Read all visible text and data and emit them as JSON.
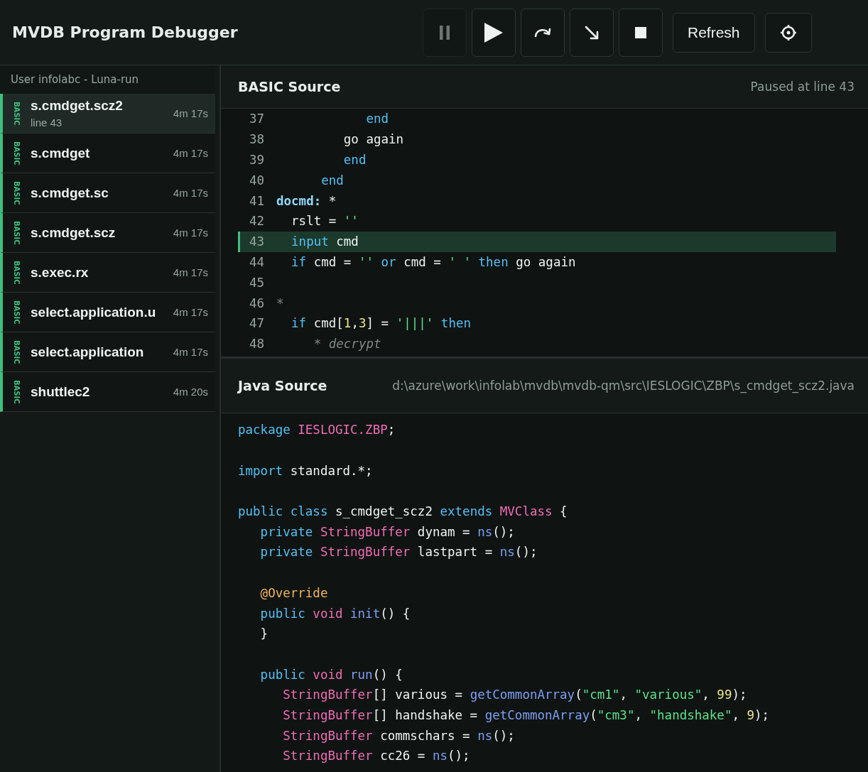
{
  "app": {
    "title": "MVDB Program Debugger"
  },
  "toolbar": {
    "buttons": [
      {
        "kind": "pause",
        "disabled": true
      },
      {
        "kind": "play",
        "disabled": false
      },
      {
        "kind": "step-over",
        "disabled": false
      },
      {
        "kind": "step-into",
        "disabled": false
      },
      {
        "kind": "stop",
        "disabled": false
      },
      {
        "kind": "text",
        "label": "Refresh",
        "disabled": false
      },
      {
        "kind": "settings",
        "disabled": false
      }
    ]
  },
  "sidebar": {
    "heading": "User infolabc - Luna-run",
    "items": [
      {
        "tag": "BASIC",
        "name": "s.cmdget.scz2",
        "time": "4m 17s",
        "detail": "line 43",
        "selected": true
      },
      {
        "tag": "BASIC",
        "name": "s.cmdget",
        "time": "4m 17s",
        "selected": false
      },
      {
        "tag": "BASIC",
        "name": "s.cmdget.sc",
        "time": "4m 17s",
        "selected": false
      },
      {
        "tag": "BASIC",
        "name": "s.cmdget.scz",
        "time": "4m 17s",
        "selected": false
      },
      {
        "tag": "BASIC",
        "name": "s.exec.rx",
        "time": "4m 17s",
        "selected": false
      },
      {
        "tag": "BASIC",
        "name": "select.application.u",
        "time": "4m 17s",
        "selected": false
      },
      {
        "tag": "BASIC",
        "name": "select.application",
        "time": "4m 17s",
        "selected": false
      },
      {
        "tag": "BASIC",
        "name": "shuttlec2",
        "time": "4m 20s",
        "selected": false
      }
    ]
  },
  "basic_source": {
    "title": "BASIC Source",
    "status": "Paused at line 43",
    "lines": [
      {
        "number": "37",
        "current": false,
        "tokens": [
          {
            "kind": "kw",
            "text": "            end"
          }
        ]
      },
      {
        "number": "38",
        "current": false,
        "tokens": [
          {
            "kind": "plain",
            "text": "         go again"
          }
        ]
      },
      {
        "number": "39",
        "current": false,
        "tokens": [
          {
            "kind": "kw",
            "text": "         end"
          }
        ]
      },
      {
        "number": "40",
        "current": false,
        "tokens": [
          {
            "kind": "kw",
            "text": "      end"
          }
        ]
      },
      {
        "number": "41",
        "current": false,
        "tokens": [
          {
            "kind": "label",
            "text": "docmd:"
          },
          {
            "kind": "plain",
            "text": " *"
          }
        ]
      },
      {
        "number": "42",
        "current": false,
        "tokens": [
          {
            "kind": "plain",
            "text": "  rslt = "
          },
          {
            "kind": "str",
            "text": "''"
          }
        ]
      },
      {
        "number": "43",
        "current": true,
        "tokens": [
          {
            "kind": "kw",
            "text": "  input"
          },
          {
            "kind": "plain",
            "text": " cmd"
          }
        ]
      },
      {
        "number": "44",
        "current": false,
        "tokens": [
          {
            "kind": "kw",
            "text": "  if"
          },
          {
            "kind": "plain",
            "text": " cmd = "
          },
          {
            "kind": "str",
            "text": "''"
          },
          {
            "kind": "kw",
            "text": " or"
          },
          {
            "kind": "plain",
            "text": " cmd = "
          },
          {
            "kind": "str",
            "text": "' '"
          },
          {
            "kind": "kw",
            "text": " then"
          },
          {
            "kind": "plain",
            "text": " go again"
          }
        ]
      },
      {
        "number": "45",
        "current": false
      },
      {
        "number": "46",
        "current": false,
        "tokens": [
          {
            "kind": "comment",
            "text": "*"
          }
        ]
      },
      {
        "number": "47",
        "current": false,
        "tokens": [
          {
            "kind": "kw",
            "text": "  if"
          },
          {
            "kind": "plain",
            "text": " cmd["
          },
          {
            "kind": "num",
            "text": "1"
          },
          {
            "kind": "plain",
            "text": ","
          },
          {
            "kind": "num",
            "text": "3"
          },
          {
            "kind": "plain",
            "text": "] = "
          },
          {
            "kind": "str",
            "text": "'|||'"
          },
          {
            "kind": "kw",
            "text": " then"
          }
        ]
      },
      {
        "number": "48",
        "current": false,
        "tokens": [
          {
            "kind": "comment",
            "text": "     * decrypt"
          }
        ]
      }
    ]
  },
  "java_source": {
    "title": "Java Source",
    "path": "d:\\azure\\work\\infolab\\mvdb\\mvdb-qm\\src\\IESLOGIC\\ZBP\\s_cmdget_scz2.java",
    "blocks": [
      {
        "lines": [
          {
            "tokens": [
              {
                "kind": "kw",
                "text": "package"
              },
              {
                "kind": "type",
                "text": " IESLOGIC.ZBP"
              },
              {
                "kind": "plain",
                "text": ";"
              }
            ]
          }
        ]
      },
      {
        "lines": [
          {
            "tokens": [
              {
                "kind": "kw",
                "text": "import"
              },
              {
                "kind": "plain",
                "text": " standard.*;"
              }
            ]
          }
        ]
      },
      {
        "lines": [
          {
            "tokens": [
              {
                "kind": "kw",
                "text": "public class"
              },
              {
                "kind": "plain",
                "text": " s_cmdget_scz2 "
              },
              {
                "kind": "kw",
                "text": "extends"
              },
              {
                "kind": "type",
                "text": " MVClass"
              },
              {
                "kind": "plain",
                "text": " {"
              }
            ]
          },
          {
            "tokens": [
              {
                "kind": "kw",
                "text": "   private"
              },
              {
                "kind": "type",
                "text": " StringBuffer"
              },
              {
                "kind": "plain",
                "text": " dynam = "
              },
              {
                "kind": "fn",
                "text": "ns"
              },
              {
                "kind": "plain",
                "text": "();"
              }
            ]
          },
          {
            "tokens": [
              {
                "kind": "kw",
                "text": "   private"
              },
              {
                "kind": "type",
                "text": " StringBuffer"
              },
              {
                "kind": "plain",
                "text": " lastpart = "
              },
              {
                "kind": "fn",
                "text": "ns"
              },
              {
                "kind": "plain",
                "text": "();"
              }
            ]
          }
        ]
      },
      {
        "lines": [
          {
            "tokens": [
              {
                "kind": "annotation",
                "text": "   @Override"
              }
            ]
          },
          {
            "tokens": [
              {
                "kind": "kw",
                "text": "   public"
              },
              {
                "kind": "type",
                "text": " void"
              },
              {
                "kind": "fn",
                "text": " init"
              },
              {
                "kind": "plain",
                "text": "() {"
              }
            ]
          },
          {
            "tokens": [
              {
                "kind": "plain",
                "text": "   }"
              }
            ]
          }
        ]
      },
      {
        "lines": [
          {
            "tokens": [
              {
                "kind": "kw",
                "text": "   public"
              },
              {
                "kind": "type",
                "text": " void"
              },
              {
                "kind": "fn",
                "text": " run"
              },
              {
                "kind": "plain",
                "text": "() {"
              }
            ]
          },
          {
            "tokens": [
              {
                "kind": "type",
                "text": "      StringBuffer"
              },
              {
                "kind": "plain",
                "text": "[] various = "
              },
              {
                "kind": "fn",
                "text": "getCommonArray"
              },
              {
                "kind": "plain",
                "text": "("
              },
              {
                "kind": "str",
                "text": "\"cm1\""
              },
              {
                "kind": "plain",
                "text": ", "
              },
              {
                "kind": "str",
                "text": "\"various\""
              },
              {
                "kind": "plain",
                "text": ", "
              },
              {
                "kind": "num",
                "text": "99"
              },
              {
                "kind": "plain",
                "text": ");"
              }
            ]
          },
          {
            "tokens": [
              {
                "kind": "type",
                "text": "      StringBuffer"
              },
              {
                "kind": "plain",
                "text": "[] handshake = "
              },
              {
                "kind": "fn",
                "text": "getCommonArray"
              },
              {
                "kind": "plain",
                "text": "("
              },
              {
                "kind": "str",
                "text": "\"cm3\""
              },
              {
                "kind": "plain",
                "text": ", "
              },
              {
                "kind": "str",
                "text": "\"handshake\""
              },
              {
                "kind": "plain",
                "text": ", "
              },
              {
                "kind": "num",
                "text": "9"
              },
              {
                "kind": "plain",
                "text": ");"
              }
            ]
          },
          {
            "tokens": [
              {
                "kind": "type",
                "text": "      StringBuffer"
              },
              {
                "kind": "plain",
                "text": " commschars = "
              },
              {
                "kind": "fn",
                "text": "ns"
              },
              {
                "kind": "plain",
                "text": "();"
              }
            ]
          },
          {
            "tokens": [
              {
                "kind": "type",
                "text": "      StringBuffer"
              },
              {
                "kind": "plain",
                "text": " cc26 = "
              },
              {
                "kind": "fn",
                "text": "ns"
              },
              {
                "kind": "plain",
                "text": "();"
              }
            ]
          }
        ]
      }
    ]
  }
}
